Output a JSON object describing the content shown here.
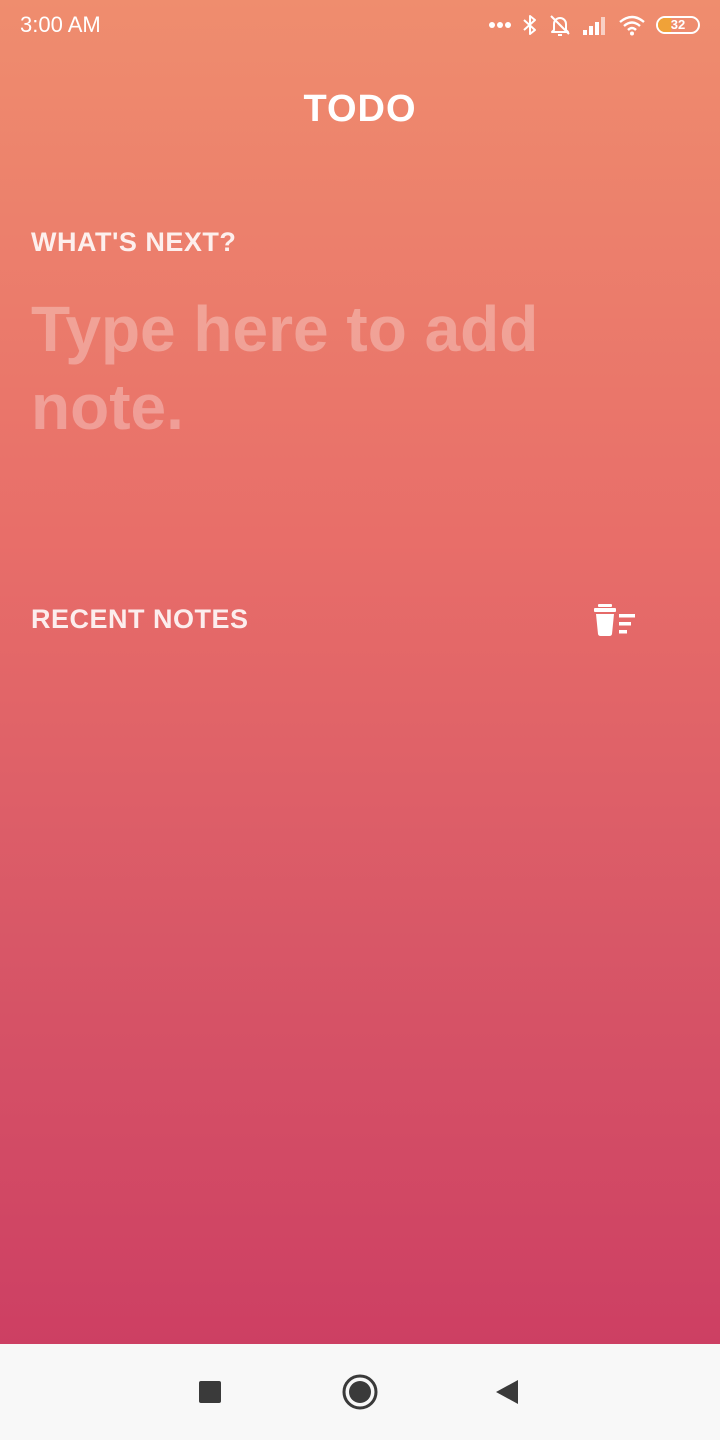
{
  "status_bar": {
    "time": "3:00 AM",
    "battery_level": "32",
    "icons": [
      "more-dots-icon",
      "bluetooth-icon",
      "alarm-off-icon",
      "signal-icon",
      "wifi-icon",
      "battery-icon"
    ]
  },
  "header": {
    "title": "TODO"
  },
  "composer": {
    "label": "WHAT'S NEXT?",
    "placeholder": "Type here to add note.",
    "value": ""
  },
  "recent": {
    "label": "RECENT NOTES",
    "clear_icon": "delete-sweep-icon",
    "items": []
  },
  "nav_bar": {
    "buttons": [
      "recents-square-icon",
      "home-circle-icon",
      "back-triangle-icon"
    ]
  },
  "colors": {
    "gradient_top": "#ef8d6e",
    "gradient_bottom": "#cd3f63",
    "text": "#ffffff",
    "nav_background": "#f8f8f8",
    "nav_icon": "#3a3a3a",
    "battery_fill": "#f0a238"
  }
}
